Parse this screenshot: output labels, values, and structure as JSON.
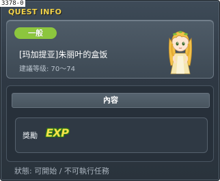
{
  "window": {
    "id_tag": "3378-0",
    "title": "QUEST INFO"
  },
  "quest": {
    "category": "一般",
    "name": "[玛加提亚]朱丽叶的盒饭",
    "level_requirement": "建議等级: 70～74",
    "npc_portrait": "juliet-npc-portrait"
  },
  "content": {
    "header": "內容",
    "reward_label": "獎勵",
    "reward_icon": "exp-icon",
    "reward_icon_text": "EXP"
  },
  "status": {
    "text": "狀態: 可開始 / 不可執行任務"
  },
  "colors": {
    "title": "#f0d24a",
    "category_badge": "#8cc63e",
    "exp_fill": "#f6e24a",
    "exp_outline": "#2d7d14"
  }
}
